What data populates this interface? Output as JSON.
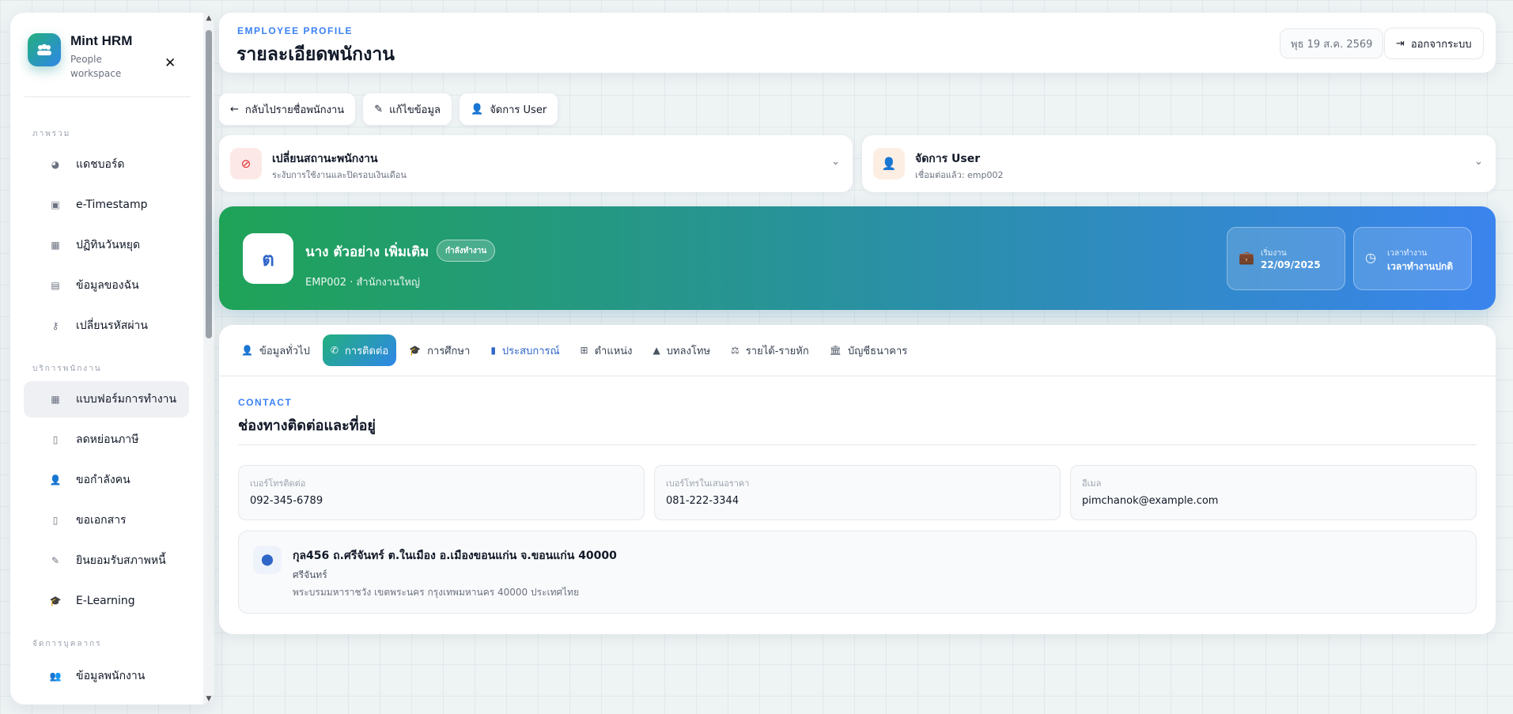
{
  "brand": {
    "name": "Mint HRM",
    "subtitle": "People workspace"
  },
  "sidebar": {
    "sections": [
      {
        "label": "ภาพรวม"
      },
      {
        "label": "บริการพนักงาน"
      },
      {
        "label": "จัดการบุคลากร"
      }
    ],
    "items": [
      {
        "label": "แดชบอร์ด",
        "icon": "chart-pie-icon"
      },
      {
        "label": "e-Timestamp",
        "icon": "camera-icon"
      },
      {
        "label": "ปฏิทินวันหยุด",
        "icon": "calendar-icon"
      },
      {
        "label": "ข้อมูลของฉัน",
        "icon": "id-card-icon"
      },
      {
        "label": "เปลี่ยนรหัสผ่าน",
        "icon": "key-icon"
      },
      {
        "label": "แบบฟอร์มการทำงาน",
        "icon": "calendar-check-icon"
      },
      {
        "label": "ลดหย่อนภาษี",
        "icon": "document-icon"
      },
      {
        "label": "ขอกำลังคน",
        "icon": "user-plus-icon"
      },
      {
        "label": "ขอเอกสาร",
        "icon": "file-icon"
      },
      {
        "label": "ยินยอมรับสภาพหนี้",
        "icon": "signature-icon"
      },
      {
        "label": "E-Learning",
        "icon": "graduation-cap-icon"
      },
      {
        "label": "ข้อมูลพนักงาน",
        "icon": "users-icon"
      }
    ]
  },
  "header": {
    "eyebrow": "EMPLOYEE PROFILE",
    "title": "รายละเอียดพนักงาน",
    "date": "พุธ 19 ส.ค. 2569",
    "logout_label": "ออกจากระบบ"
  },
  "actions": {
    "back": "กลับไปรายชื่อพนักงาน",
    "edit": "แก้ไขข้อมูล",
    "manage_user": "จัดการ User"
  },
  "panels": {
    "status": {
      "title": "เปลี่ยนสถานะพนักงาน",
      "subtitle": "ระงับการใช้งานและปิดรอบเงินเดือน"
    },
    "user": {
      "title": "จัดการ User",
      "subtitle": "เชื่อมต่อแล้ว: emp002"
    }
  },
  "employee": {
    "initial": "ต",
    "name": "นาง ตัวอย่าง เพิ่มเติม",
    "status_badge": "กำลังทำงาน",
    "meta": "EMP002 · สำนักงานใหญ่",
    "start_label": "เริ่มงาน",
    "start_value": "22/09/2025",
    "shift_label": "เวลาทำงาน",
    "shift_value": "เวลาทำงานปกติ"
  },
  "tabs": [
    {
      "label": "ข้อมูลทั่วไป",
      "icon": "user-icon"
    },
    {
      "label": "การติดต่อ",
      "icon": "phone-icon"
    },
    {
      "label": "การศึกษา",
      "icon": "graduation-cap-icon"
    },
    {
      "label": "ประสบการณ์",
      "icon": "bookmark-icon"
    },
    {
      "label": "ตำแหน่ง",
      "icon": "sitemap-icon"
    },
    {
      "label": "บทลงโทษ",
      "icon": "warning-icon"
    },
    {
      "label": "รายได้-รายหัก",
      "icon": "scale-icon"
    },
    {
      "label": "บัญชีธนาคาร",
      "icon": "bank-icon"
    }
  ],
  "contact": {
    "eyebrow": "CONTACT",
    "title": "ช่องทางติดต่อและที่อยู่",
    "phone_label": "เบอร์โทรติดต่อ",
    "phone_value": "092-345-6789",
    "emergency_label": "เบอร์โทรในเสนอราคา",
    "emergency_value": "081-222-3344",
    "email_label": "อีเมล",
    "email_value": "pimchanok@example.com",
    "address_main": "กุล456 ถ.ศรีจันทร์ ต.ในเมือง อ.เมืองขอนแก่น จ.ขอนแก่น 40000",
    "address_line1": "ศรีจันทร์",
    "address_line2": "พระบรมมหาราชวัง เขตพระนคร กรุงเทพมหานคร 40000 ประเทศไทย"
  },
  "colors": {
    "accent": "#2f86e8",
    "brand_green": "#22b07d",
    "hero_start": "#1fa357",
    "hero_end": "#3a84ee"
  }
}
